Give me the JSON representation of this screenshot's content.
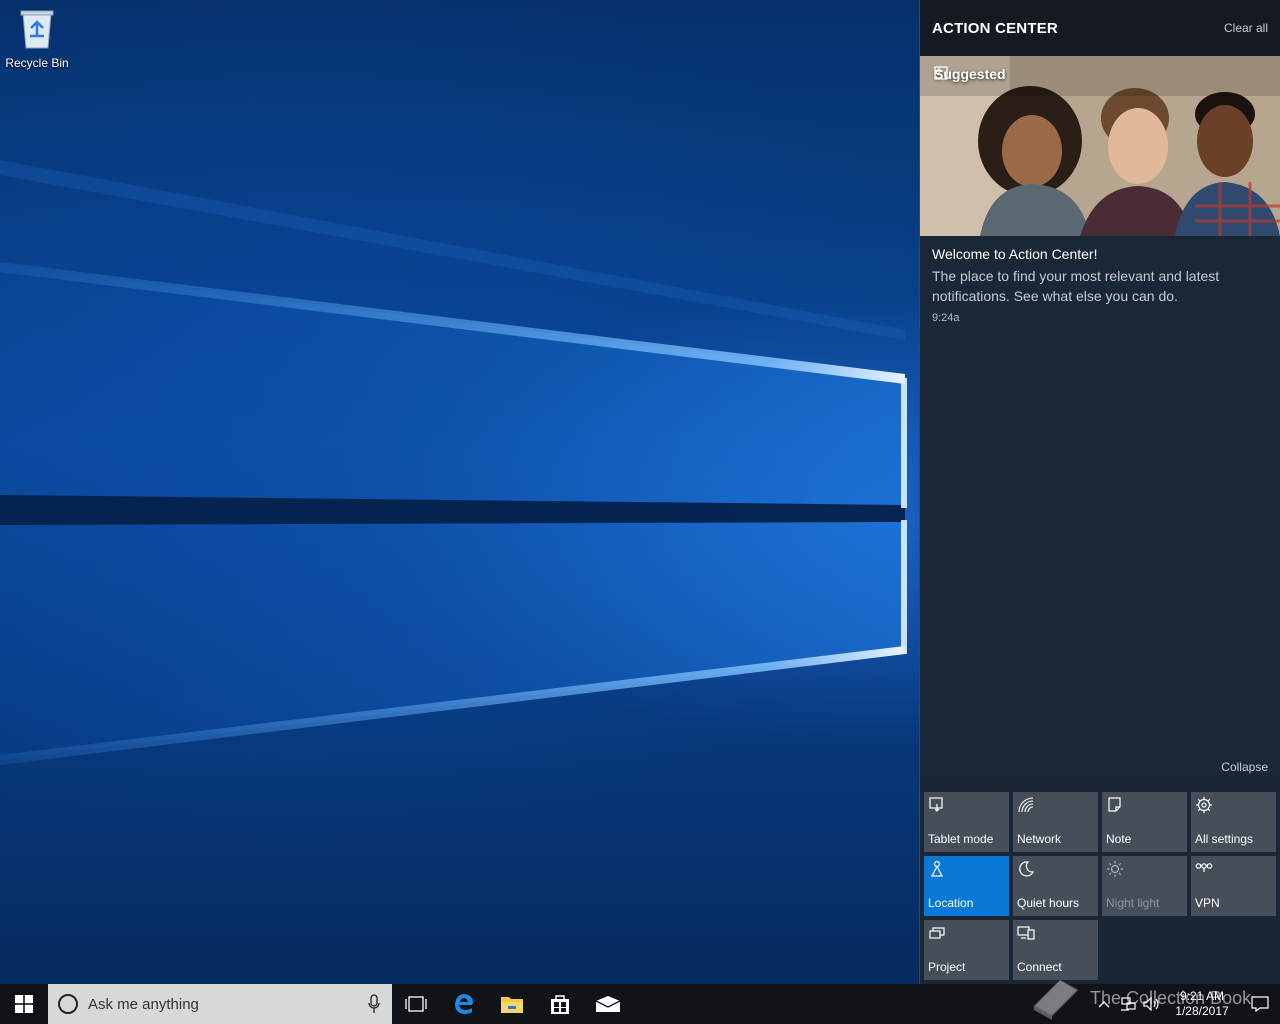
{
  "desktop": {
    "icons": [
      {
        "label": "Recycle Bin",
        "icon": "recycle-bin-icon"
      }
    ]
  },
  "action_center": {
    "title": "ACTION CENTER",
    "clear_all": "Clear all",
    "notification": {
      "category": "Suggested",
      "title": "Welcome to Action Center!",
      "body": "The place to find your most relevant and latest notifications. See what else you can do.",
      "time": "9:24a"
    },
    "collapse": "Collapse",
    "quick_actions": [
      {
        "label": "Tablet mode",
        "icon": "tablet-mode-icon",
        "state": "off"
      },
      {
        "label": "Network",
        "icon": "network-icon",
        "state": "off"
      },
      {
        "label": "Note",
        "icon": "note-icon",
        "state": "off"
      },
      {
        "label": "All settings",
        "icon": "gear-icon",
        "state": "off"
      },
      {
        "label": "Location",
        "icon": "location-icon",
        "state": "on"
      },
      {
        "label": "Quiet hours",
        "icon": "moon-icon",
        "state": "off"
      },
      {
        "label": "Night light",
        "icon": "sun-icon",
        "state": "disabled"
      },
      {
        "label": "VPN",
        "icon": "vpn-icon",
        "state": "off"
      },
      {
        "label": "Project",
        "icon": "project-icon",
        "state": "off"
      },
      {
        "label": "Connect",
        "icon": "connect-icon",
        "state": "off"
      }
    ]
  },
  "taskbar": {
    "search_placeholder": "Ask me anything",
    "apps": [
      "task-view-icon",
      "edge-icon",
      "file-explorer-icon",
      "store-icon",
      "mail-icon"
    ],
    "clock": {
      "time": "9:21 AM",
      "date": "1/28/2017"
    }
  },
  "watermark": "The Collection Book",
  "colors": {
    "accent": "#0a78d7",
    "tile": "#50586a",
    "panel": "#1c2632"
  }
}
